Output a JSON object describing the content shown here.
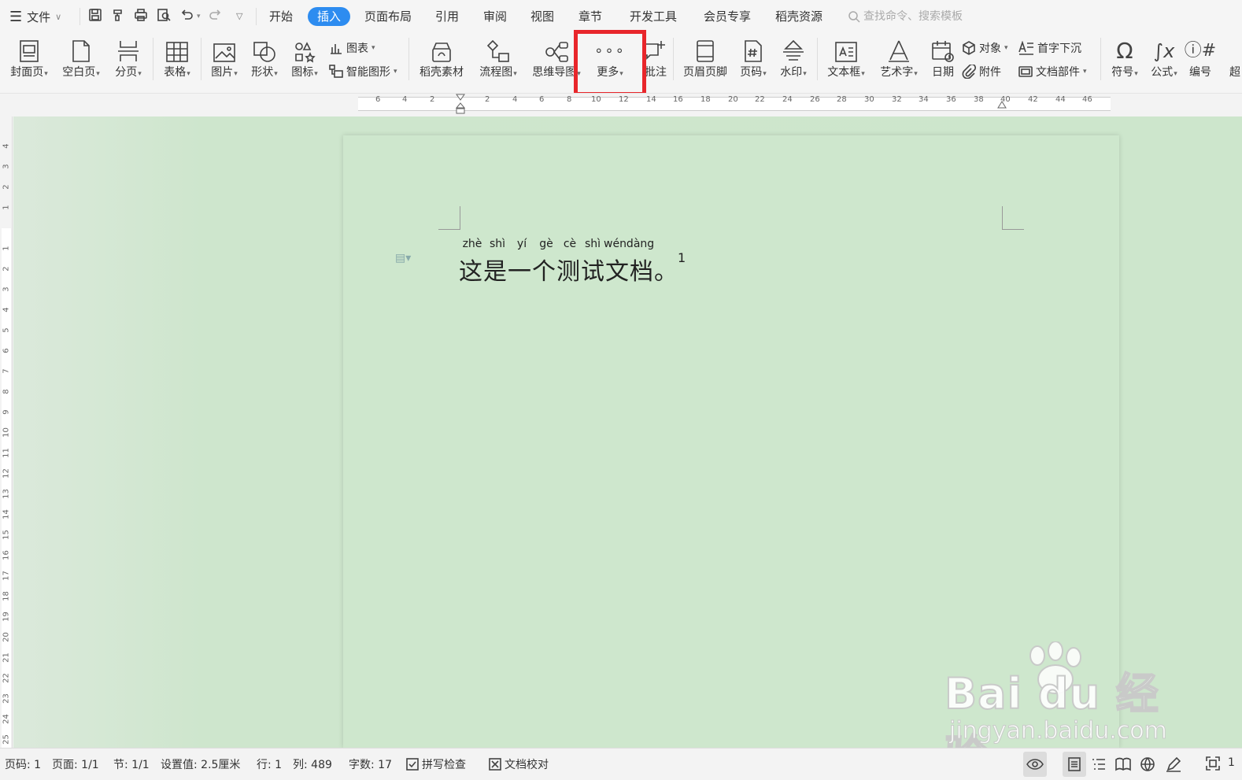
{
  "menubar": {
    "file_label": "文件",
    "tabs": [
      "开始",
      "插入",
      "页面布局",
      "引用",
      "审阅",
      "视图",
      "章节",
      "开发工具",
      "会员专享",
      "稻壳资源"
    ],
    "active_tab": "插入",
    "search_placeholder": "查找命令、搜索模板"
  },
  "ribbon": {
    "buttons": {
      "cover": "封面页",
      "blank": "空白页",
      "pagebreak": "分页",
      "table": "表格",
      "picture": "图片",
      "shape": "形状",
      "icon": "图标",
      "material": "稻壳素材",
      "flowchart": "流程图",
      "mindmap": "思维导图",
      "more": "更多",
      "comment": "批注",
      "headerfooter": "页眉页脚",
      "pagenum": "页码",
      "watermark": "水印",
      "textbox": "文本框",
      "wordart": "艺术字",
      "date": "日期",
      "symbol": "符号",
      "formula": "公式",
      "numbering": "编号",
      "overflow": "超"
    },
    "small": {
      "chart": "图表",
      "smartart": "智能图形",
      "object": "对象",
      "attachment": "附件",
      "dropcap": "首字下沉",
      "docparts": "文档部件"
    },
    "highlight_color": "#e8262b"
  },
  "ruler": {
    "h_numbers": [
      "6",
      "4",
      "2",
      "2",
      "4",
      "6",
      "8",
      "10",
      "12",
      "14",
      "16",
      "18",
      "20",
      "22",
      "24",
      "26",
      "28",
      "30",
      "32",
      "34",
      "36",
      "38",
      "40",
      "42",
      "44",
      "46"
    ],
    "v_numbers": [
      "4",
      "3",
      "2",
      "1",
      "1",
      "2",
      "3",
      "4",
      "5",
      "6",
      "7",
      "8",
      "9",
      "10",
      "11",
      "12",
      "13",
      "14",
      "15",
      "16",
      "17",
      "18",
      "19",
      "20",
      "21",
      "22",
      "23",
      "24",
      "25"
    ]
  },
  "document": {
    "pinyin": [
      "zhè",
      "shì",
      "yí",
      "gè",
      "cè",
      "shì",
      "wéndàng"
    ],
    "text": "这是一个测试文档。",
    "footnote_mark": "1"
  },
  "watermark": {
    "brand": "Bai du 经验",
    "url": "jingyan.baidu.com"
  },
  "statusbar": {
    "page_num": "页码: 1",
    "page": "页面: 1/1",
    "section": "节: 1/1",
    "setting": "设置值: 2.5厘米",
    "row": "行: 1",
    "col": "列: 489",
    "wordcount": "字数: 17",
    "spellcheck": "拼写检查",
    "proofread": "文档校对",
    "zoom_partial": "1"
  },
  "colors": {
    "accent": "#2d8cf0",
    "page_bg": "#cee7cd",
    "annotation_red": "#e8262b"
  }
}
